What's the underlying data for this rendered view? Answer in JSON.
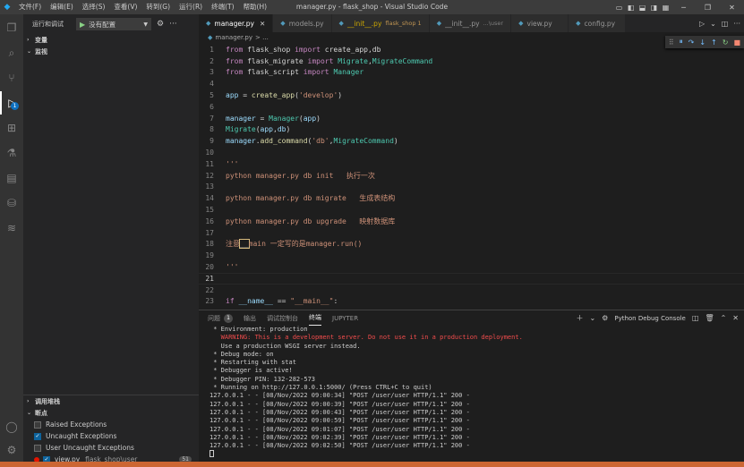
{
  "titlebar": {
    "menus": [
      "文件(F)",
      "编辑(E)",
      "选择(S)",
      "查看(V)",
      "转到(G)",
      "运行(R)",
      "终端(T)",
      "帮助(H)"
    ],
    "title": "manager.py - flask_shop - Visual Studio Code"
  },
  "activity": {
    "debug_badge": "1"
  },
  "sidebar": {
    "header": "运行和调试",
    "run_config": "没有配置",
    "sections": {
      "variables": "变量",
      "watch": "监视",
      "callstack": "调用堆栈",
      "breakpoints": "断点"
    },
    "breakpoints": [
      {
        "label": "Raised Exceptions",
        "checked": false
      },
      {
        "label": "Uncaught Exceptions",
        "checked": true
      },
      {
        "label": "User Uncaught Exceptions",
        "checked": false
      }
    ],
    "file_bp": {
      "file": "view.py",
      "path": "flask_shop\\user",
      "line": "51"
    }
  },
  "tabs": [
    {
      "label": "manager.py",
      "active": true
    },
    {
      "label": "models.py",
      "active": false
    },
    {
      "label": "__init__.py",
      "active": false,
      "sub": "flask_shop 1"
    },
    {
      "label": "__init__.py",
      "active": false,
      "sub": "...\\user"
    },
    {
      "label": "view.py",
      "active": false
    },
    {
      "label": "config.py",
      "active": false
    }
  ],
  "breadcrumb": {
    "file": "manager.py",
    "sep": "> ..."
  },
  "code": {
    "lines": [
      {
        "n": "1",
        "t": [
          [
            "kw",
            "from "
          ],
          [
            "tx",
            "flask_shop "
          ],
          [
            "kw",
            "import "
          ],
          [
            "tx",
            "create_app,db"
          ]
        ]
      },
      {
        "n": "2",
        "t": [
          [
            "kw",
            "from "
          ],
          [
            "tx",
            "flask_migrate "
          ],
          [
            "kw",
            "import "
          ],
          [
            "cls",
            "Migrate"
          ],
          [
            "tx",
            ","
          ],
          [
            "cls",
            "MigrateCommand"
          ]
        ]
      },
      {
        "n": "3",
        "t": [
          [
            "kw",
            "from "
          ],
          [
            "tx",
            "flask_script "
          ],
          [
            "kw",
            "import "
          ],
          [
            "cls",
            "Manager"
          ]
        ]
      },
      {
        "n": "4",
        "t": []
      },
      {
        "n": "5",
        "t": [
          [
            "var",
            "app "
          ],
          [
            "tx",
            "= "
          ],
          [
            "fn",
            "create_app"
          ],
          [
            "tx",
            "("
          ],
          [
            "str",
            "'develop'"
          ],
          [
            "tx",
            ")"
          ]
        ]
      },
      {
        "n": "6",
        "t": []
      },
      {
        "n": "7",
        "t": [
          [
            "var",
            "manager "
          ],
          [
            "tx",
            "= "
          ],
          [
            "cls",
            "Manager"
          ],
          [
            "tx",
            "("
          ],
          [
            "var",
            "app"
          ],
          [
            "tx",
            ")"
          ]
        ]
      },
      {
        "n": "8",
        "t": [
          [
            "cls",
            "Migrate"
          ],
          [
            "tx",
            "("
          ],
          [
            "var",
            "app"
          ],
          [
            "tx",
            ","
          ],
          [
            "var",
            "db"
          ],
          [
            "tx",
            ")"
          ]
        ]
      },
      {
        "n": "9",
        "t": [
          [
            "var",
            "manager"
          ],
          [
            "tx",
            "."
          ],
          [
            "fn",
            "add_command"
          ],
          [
            "tx",
            "("
          ],
          [
            "str",
            "'db'"
          ],
          [
            "tx",
            ","
          ],
          [
            "cls",
            "MigrateCommand"
          ],
          [
            "tx",
            ")"
          ]
        ]
      },
      {
        "n": "10",
        "t": []
      },
      {
        "n": "11",
        "t": [
          [
            "cmt",
            "'''"
          ]
        ]
      },
      {
        "n": "12",
        "t": [
          [
            "cmt",
            "python manager.py db init   执行一次"
          ]
        ]
      },
      {
        "n": "13",
        "t": []
      },
      {
        "n": "14",
        "t": [
          [
            "cmt",
            "python manager.py db migrate   生成表结构"
          ]
        ]
      },
      {
        "n": "15",
        "t": []
      },
      {
        "n": "16",
        "t": [
          [
            "cmt",
            "python manager.py db upgrade   映射数据库"
          ]
        ]
      },
      {
        "n": "17",
        "t": []
      },
      {
        "n": "18",
        "t": [
          [
            "cmt",
            "注意"
          ],
          [
            "hl",
            "__"
          ],
          [
            "cmt",
            "main 一定写的是manager.run()"
          ]
        ]
      },
      {
        "n": "19",
        "t": []
      },
      {
        "n": "20",
        "t": [
          [
            "cmt",
            "'''"
          ]
        ]
      },
      {
        "n": "21",
        "t": [],
        "current": true
      },
      {
        "n": "22",
        "t": []
      },
      {
        "n": "23",
        "t": [
          [
            "kw",
            "if "
          ],
          [
            "var",
            "__name__ "
          ],
          [
            "tx",
            "== "
          ],
          [
            "str",
            "\"__main__\""
          ],
          [
            "tx",
            ":"
          ]
        ]
      }
    ]
  },
  "panel": {
    "tabs": [
      {
        "label": "问题",
        "badge": "1",
        "active": false
      },
      {
        "label": "输出",
        "active": false
      },
      {
        "label": "调试控制台",
        "active": false
      },
      {
        "label": "终端",
        "active": true
      },
      {
        "label": "JUPYTER",
        "active": false
      }
    ],
    "terminal_name": "Python Debug Console",
    "lines": [
      {
        "text": " * Environment: production",
        "warn": false
      },
      {
        "text": "   WARNING: This is a development server. Do not use it in a production deployment.",
        "warn": true
      },
      {
        "text": "   Use a production WSGI server instead.",
        "warn": false
      },
      {
        "text": " * Debug mode: on",
        "warn": false
      },
      {
        "text": " * Restarting with stat",
        "warn": false
      },
      {
        "text": " * Debugger is active!",
        "warn": false
      },
      {
        "text": " * Debugger PIN: 132-282-573",
        "warn": false
      },
      {
        "text": " * Running on http://127.0.0.1:5000/ (Press CTRL+C to quit)",
        "warn": false
      },
      {
        "text": "127.0.0.1 - - [08/Nov/2022 09:00:34] \"POST /user/user HTTP/1.1\" 200 -",
        "warn": false
      },
      {
        "text": "127.0.0.1 - - [08/Nov/2022 09:00:39] \"POST /user/user HTTP/1.1\" 200 -",
        "warn": false
      },
      {
        "text": "127.0.0.1 - - [08/Nov/2022 09:00:43] \"POST /user/user HTTP/1.1\" 200 -",
        "warn": false
      },
      {
        "text": "127.0.0.1 - - [08/Nov/2022 09:00:59] \"POST /user/user HTTP/1.1\" 200 -",
        "warn": false
      },
      {
        "text": "127.0.0.1 - - [08/Nov/2022 09:01:07] \"POST /user/user HTTP/1.1\" 200 -",
        "warn": false
      },
      {
        "text": "127.0.0.1 - - [08/Nov/2022 09:02:39] \"POST /user/user HTTP/1.1\" 200 -",
        "warn": false
      },
      {
        "text": "127.0.0.1 - - [08/Nov/2022 09:02:50] \"POST /user/user HTTP/1.1\" 200 -",
        "warn": false
      }
    ]
  },
  "colors": {
    "statusbar": "#cc6633",
    "accent": "#0e639c",
    "warning": "#f14c4c"
  }
}
